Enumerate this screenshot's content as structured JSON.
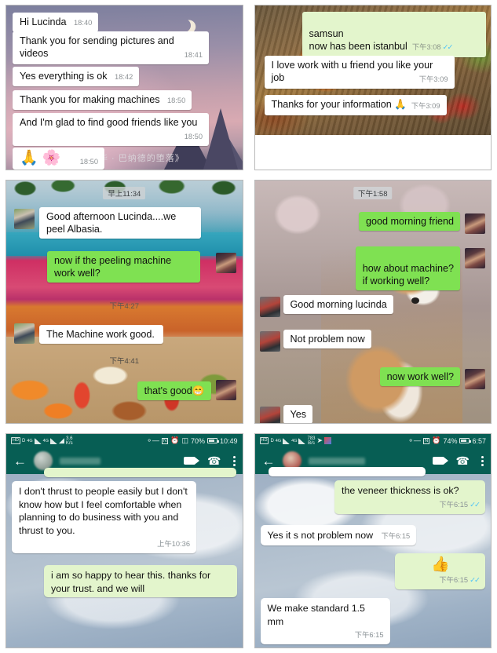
{
  "page": {
    "title": "WhatsApp and WeChat customer chat screenshots collage",
    "columns": 2,
    "rows": 3
  },
  "panels": [
    {
      "id": "panel-1",
      "app": "whatsapp",
      "wallpaper": "night-sky-mountains",
      "overlay_text": "华 · 巴纳德的堕落》",
      "messages": [
        {
          "side": "in",
          "text": "Hi Lucinda",
          "time": "18:40"
        },
        {
          "side": "in",
          "text": "Thank you for sending pictures and videos",
          "time": "18:41"
        },
        {
          "side": "in",
          "text": "Yes everything is ok",
          "time": "18:42"
        },
        {
          "side": "in",
          "text": "Thank you for making machines",
          "time": "18:50"
        },
        {
          "side": "in",
          "text": "And I'm glad to find good friends like you",
          "time": "18:50"
        },
        {
          "side": "in",
          "text": "🙏 🌸",
          "time": "18:50",
          "is_emoji": true
        }
      ]
    },
    {
      "id": "panel-2",
      "app": "whatsapp",
      "wallpaper": "food-table-photo",
      "messages": [
        {
          "side": "out",
          "text": "samsun\nnow has been istanbul",
          "time": "下午3:08",
          "ticks": "✓✓"
        },
        {
          "side": "in",
          "text": "I love work with u friend you like your job",
          "time": "下午3:09"
        },
        {
          "side": "in",
          "text": "Thanks for your information 🙏",
          "time": "下午3:09"
        }
      ]
    },
    {
      "id": "panel-3",
      "app": "wechat",
      "wallpaper": "resort-pool-breakfast",
      "day_divider": "早上11:34",
      "messages": [
        {
          "side": "in",
          "text": "Good afternoon Lucinda....we peel Albasia.",
          "avatar": "man"
        },
        {
          "side": "out",
          "text": "now if the peeling machine work well?",
          "avatar": "lady"
        },
        {
          "side": "time",
          "text": "下午4:27"
        },
        {
          "side": "in",
          "text": "The Machine work good.",
          "avatar": "man"
        },
        {
          "side": "time",
          "text": "下午4:41"
        },
        {
          "side": "out",
          "text": "that's good😁",
          "avatar": "lady"
        }
      ]
    },
    {
      "id": "panel-4",
      "app": "wechat",
      "wallpaper": "corgi-dog-blossom",
      "day_divider": "下午1:58",
      "messages": [
        {
          "side": "out",
          "text": "good morning friend",
          "avatar": "lady"
        },
        {
          "side": "out",
          "text": "how about machine?\nif working well?",
          "avatar": "lady"
        },
        {
          "side": "in",
          "text": "Good morning lucinda",
          "avatar": "bear"
        },
        {
          "side": "in",
          "text": "Not problem now",
          "avatar": "bear"
        },
        {
          "side": "out",
          "text": "now work well?",
          "avatar": "lady"
        },
        {
          "side": "in",
          "text": "Yes",
          "avatar": "bear"
        }
      ]
    },
    {
      "id": "panel-5",
      "app": "whatsapp",
      "wallpaper": "cloudy-sky",
      "status_bar": {
        "hd_badge": "HD",
        "data_badge": "D",
        "net1": "4G",
        "net2": "4G",
        "speed_value": "3.6",
        "speed_unit": "K/s",
        "battery_percent": "70%",
        "clock": "10:49"
      },
      "header": {
        "back": "←",
        "contact_name": "",
        "video_call": "video-call",
        "voice_call": "voice-call",
        "menu": "menu"
      },
      "messages": [
        {
          "side": "in",
          "text": "I don't thrust to people easily but I  don't know how but I feel comfortable when planning to do business with you and thrust to you.",
          "time": "上午10:36"
        },
        {
          "side": "out",
          "text": "i am so happy to hear this. thanks for your trust. and we will",
          "time": ""
        }
      ]
    },
    {
      "id": "panel-6",
      "app": "whatsapp",
      "wallpaper": "cloudy-sky",
      "status_bar": {
        "hd_badge": "HD",
        "data_badge": "D",
        "net1": "4G",
        "net2": "4G",
        "speed_value": "783",
        "speed_unit": "B/s",
        "battery_percent": "74%",
        "clock": "6:57"
      },
      "header": {
        "back": "←",
        "contact_name": "",
        "video_call": "video-call",
        "voice_call": "voice-call",
        "menu": "menu"
      },
      "messages": [
        {
          "side": "out",
          "text": "the veneer thickness is ok?",
          "time": "下午6:15",
          "ticks": "✓✓"
        },
        {
          "side": "in",
          "text": "Yes it s not problem now",
          "time": "下午6:15"
        },
        {
          "side": "out",
          "text": "👍",
          "time": "下午6:15",
          "ticks": "✓✓",
          "is_emoji": true
        },
        {
          "side": "in",
          "text": "We make standard 1.5 mm",
          "time": "下午6:15"
        }
      ]
    }
  ],
  "colors": {
    "whatsapp_header": "#075e54",
    "bubble_incoming": "#ffffff",
    "bubble_outgoing_pale": "#e3f5cc",
    "bubble_outgoing_vivid": "#7fe152",
    "tick_blue": "#4fc3f7",
    "meta_grey": "#8a9296"
  }
}
